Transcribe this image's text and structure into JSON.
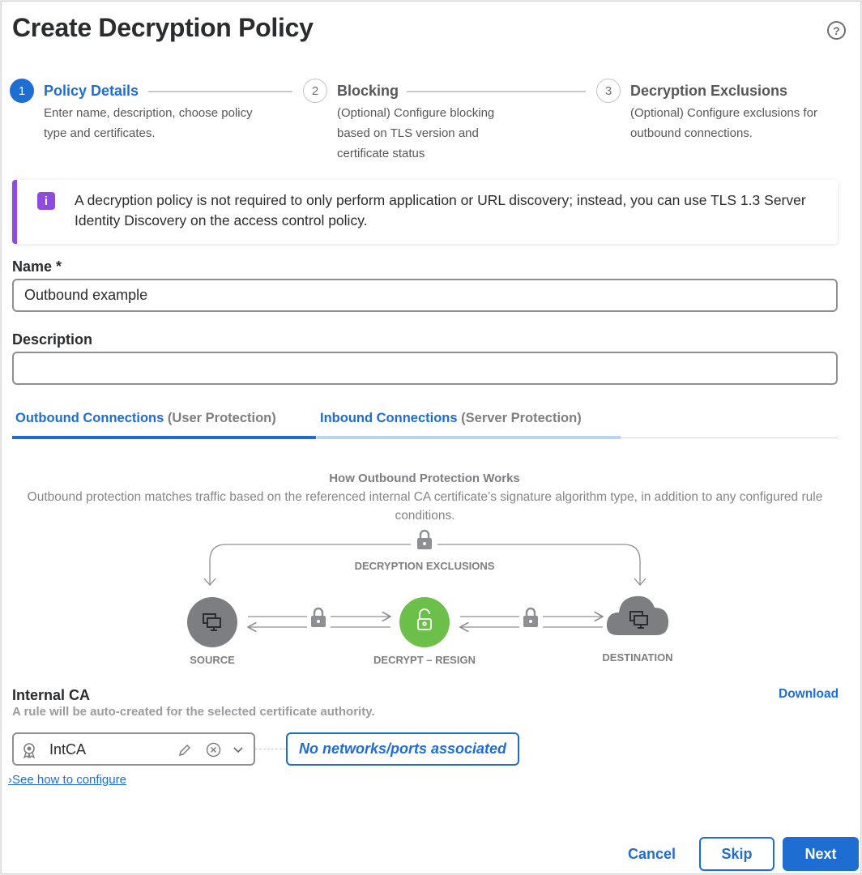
{
  "dialog": {
    "title": "Create Decryption Policy",
    "help_icon": "question-circle-icon",
    "help_glyph": "?"
  },
  "stepper": {
    "steps": [
      {
        "number": "1",
        "name": "Policy Details",
        "description": "Enter name, description, choose policy type and certificates.",
        "state": "active"
      },
      {
        "number": "2",
        "name": "Blocking",
        "description": "(Optional) Configure blocking based on TLS version and certificate status",
        "state": "inactive"
      },
      {
        "number": "3",
        "name": "Decryption Exclusions",
        "description": "(Optional) Configure exclusions for outbound connections.",
        "state": "inactive"
      }
    ]
  },
  "banner": {
    "icon": "info-icon",
    "icon_glyph": "i",
    "text": "A decryption policy is not required to only perform application or URL discovery; instead, you can use TLS 1.3 Server Identity Discovery on the access control policy."
  },
  "form": {
    "name_label": "Name *",
    "name_value": "Outbound example",
    "description_label": "Description",
    "description_value": ""
  },
  "tabs": [
    {
      "main": "Outbound Connections",
      "sub": "(User Protection)",
      "active": true
    },
    {
      "main": "Inbound Connections",
      "sub": "(Server Protection)",
      "active": false
    }
  ],
  "how_it_works": {
    "title": "How Outbound Protection Works",
    "description": "Outbound protection matches traffic based on the referenced internal CA certificate’s signature algorithm type, in addition to any configured rule conditions.",
    "exclusions_label": "DECRYPTION EXCLUSIONS",
    "source_label": "SOURCE",
    "decrypt_label": "DECRYPT – RESIGN",
    "destination_label": "DESTINATION",
    "icons": [
      "lock-icon",
      "monitor-icon",
      "unlock-icon",
      "cloud-icon",
      "arrow-icon"
    ]
  },
  "internal_ca": {
    "label": "Internal CA",
    "help": "A rule will be auto-created for the selected certificate authority.",
    "download": "Download",
    "selected": "IntCA",
    "status": "No networks/ports associated",
    "see_how": "See how to configure",
    "chevron_glyph": "›"
  },
  "footer": {
    "cancel": "Cancel",
    "skip": "Skip",
    "next": "Next"
  },
  "colors": {
    "primary": "#1e6dd3",
    "banner_accent": "#8f4bdf",
    "decrypt_node": "#6cc04a",
    "node_gray": "#7d7e82"
  }
}
